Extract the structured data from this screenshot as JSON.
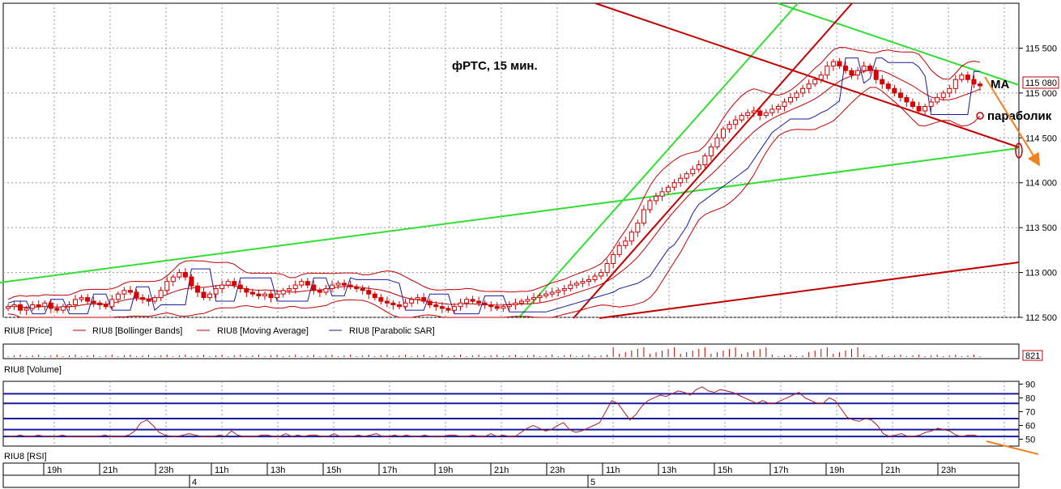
{
  "chart_data": {
    "type": "candlestick",
    "title": "фРТС, 15 мин.",
    "instrument": "RIU8",
    "price_panel": {
      "ylim": [
        112500,
        116000
      ],
      "yticks": [
        112500,
        113000,
        113500,
        114000,
        114500,
        115000,
        115500
      ],
      "ytick_labels": [
        "112 500",
        "113 000",
        "113 500",
        "114 000",
        "114 500",
        "115 000",
        "115 500"
      ],
      "last_price_label": "115 080",
      "closes_approx": [
        112620,
        112640,
        112580,
        112600,
        112640,
        112620,
        112660,
        112600,
        112580,
        112620,
        112640,
        112700,
        112720,
        112680,
        112660,
        112640,
        112620,
        112700,
        112760,
        112800,
        112780,
        112720,
        112700,
        112680,
        112720,
        112800,
        112900,
        112950,
        113000,
        112950,
        112850,
        112780,
        112720,
        112760,
        112820,
        112860,
        112900,
        112860,
        112820,
        112780,
        112760,
        112740,
        112760,
        112720,
        112760,
        112800,
        112820,
        112860,
        112900,
        112860,
        112800,
        112780,
        112820,
        112860,
        112880,
        112860,
        112840,
        112820,
        112800,
        112760,
        112720,
        112680,
        112660,
        112640,
        112620,
        112660,
        112700,
        112720,
        112680,
        112640,
        112620,
        112600,
        112580,
        112620,
        112660,
        112700,
        112680,
        112660,
        112640,
        112620,
        112600,
        112620,
        112640,
        112660,
        112680,
        112700,
        112720,
        112740,
        112760,
        112780,
        112800,
        112820,
        112860,
        112880,
        112900,
        112920,
        112960,
        113000,
        113100,
        113200,
        113300,
        113350,
        113450,
        113550,
        113700,
        113800,
        113850,
        113900,
        113950,
        114000,
        114050,
        114100,
        114150,
        114200,
        114300,
        114400,
        114500,
        114600,
        114650,
        114700,
        114750,
        114780,
        114800,
        114750,
        114780,
        114820,
        114850,
        114900,
        114950,
        115000,
        115050,
        115100,
        115150,
        115200,
        115300,
        115350,
        115300,
        115250,
        115200,
        115250,
        115300,
        115250,
        115150,
        115100,
        115050,
        115000,
        114950,
        114900,
        114850,
        114800,
        114850,
        114900,
        114950,
        115000,
        115050,
        115150,
        115200,
        115150,
        115100,
        115080
      ]
    },
    "legend": [
      {
        "name": "RIU8 [Price]",
        "color": "#dd0000"
      },
      {
        "name": "RIU8 [Bollinger Bands]",
        "color": "#c00000"
      },
      {
        "name": "RIU8 [Moving Average]",
        "color": "#c00000"
      },
      {
        "name": "RIU8 [Parabolic SAR]",
        "color": "#1a1aa0"
      }
    ],
    "volume_panel": {
      "label": "RIU8 [Volume]",
      "last_label": "821"
    },
    "rsi_panel": {
      "label": "RIU8 [RSI]",
      "ylim": [
        45,
        92
      ],
      "yticks": [
        50,
        60,
        70,
        80,
        90
      ],
      "levels": [
        52,
        57,
        65,
        76,
        83
      ],
      "values_approx": [
        52,
        52,
        53,
        52,
        52,
        53,
        52,
        52,
        52,
        53,
        52,
        52,
        52,
        52,
        52,
        52,
        53,
        52,
        52,
        52,
        53,
        56,
        62,
        64,
        60,
        55,
        53,
        52,
        52,
        53,
        54,
        53,
        52,
        52,
        52,
        53,
        52,
        56,
        53,
        52,
        52,
        52,
        53,
        53,
        52,
        52,
        54,
        52,
        53,
        52,
        53,
        53,
        52,
        52,
        54,
        52,
        52,
        52,
        53,
        52,
        53,
        54,
        52,
        52,
        53,
        52,
        53,
        52,
        52,
        53,
        52,
        52,
        52,
        53,
        53,
        52,
        52,
        53,
        52,
        52,
        54,
        52,
        53,
        52,
        52,
        55,
        58,
        60,
        58,
        56,
        57,
        60,
        62,
        57,
        55,
        56,
        58,
        60,
        62,
        70,
        78,
        76,
        70,
        64,
        68,
        74,
        78,
        80,
        82,
        81,
        83,
        85,
        84,
        82,
        86,
        88,
        85,
        84,
        86,
        85,
        84,
        82,
        80,
        78,
        76,
        78,
        76,
        76,
        78,
        80,
        82,
        84,
        80,
        78,
        76,
        76,
        80,
        78,
        72,
        66,
        64,
        63,
        65,
        64,
        60,
        54,
        52,
        53,
        54,
        52,
        52,
        53,
        55,
        56,
        58,
        57,
        56,
        53,
        52,
        53,
        53,
        52
      ]
    },
    "x_axis": {
      "hour_labels": [
        "19h",
        "21h",
        "23h",
        "11h",
        "13h",
        "15h",
        "17h",
        "19h",
        "21h",
        "23h",
        "11h",
        "13h",
        "15h",
        "17h",
        "19h",
        "21h",
        "23h"
      ],
      "day_labels": [
        "4",
        "5"
      ]
    },
    "annotations": [
      "MA",
      "параболик"
    ]
  }
}
